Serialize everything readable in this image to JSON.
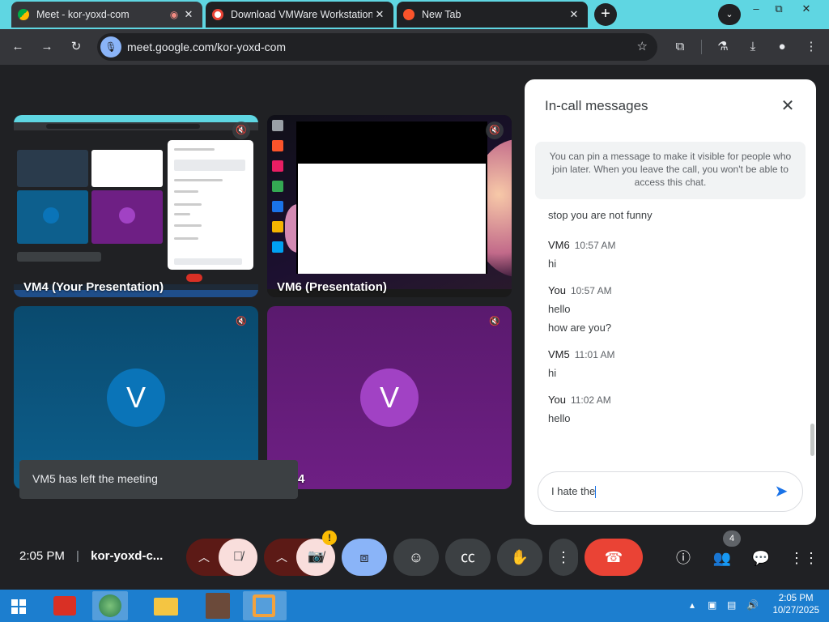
{
  "browser": {
    "tabs": [
      {
        "title": "Meet - kor-yoxd-com",
        "favicon": "google-meet-icon",
        "active": true
      },
      {
        "title": "Download VMWare Workstation",
        "favicon": "opera-icon",
        "active": false
      },
      {
        "title": "New Tab",
        "favicon": "brave-icon",
        "active": false
      }
    ],
    "url": "meet.google.com/kor-yoxd-com",
    "new_tab_glyph": "+",
    "window_controls": {
      "minimize": "–",
      "maximize": "⧉",
      "close": "✕"
    }
  },
  "meeting": {
    "tiles": [
      {
        "name": "VM4 (Your Presentation)",
        "kind": "presentation"
      },
      {
        "name": "VM6 (Presentation)",
        "kind": "presentation"
      },
      {
        "avatar_letter": "V",
        "color": "#0a74b8"
      },
      {
        "avatar_letter": "V",
        "color": "#a142c4",
        "partial_name": "4"
      }
    ],
    "toast": "VM5 has left the meeting",
    "clock": "2:05 PM",
    "meeting_code": "kor-yoxd-c...",
    "participant_count": "4",
    "camera_warning": "!"
  },
  "chat_panel": {
    "title": "In-call messages",
    "pin_note": "You can pin a message to make it visible for people who join later. When you leave the call, you won't be able to access this chat.",
    "orphan_line": "stop you are not funny",
    "messages": [
      {
        "sender": "VM6",
        "time": "10:57 AM",
        "lines": [
          "hi"
        ]
      },
      {
        "sender": "You",
        "time": "10:57 AM",
        "lines": [
          "hello",
          "how are you?"
        ]
      },
      {
        "sender": "VM5",
        "time": "11:01 AM",
        "lines": [
          "hi"
        ]
      },
      {
        "sender": "You",
        "time": "11:02 AM",
        "lines": [
          "hello"
        ]
      }
    ],
    "draft": "I hate the"
  },
  "taskbar": {
    "time": "2:05 PM",
    "date": "10/27/2025"
  },
  "colors": {
    "accent": "#1a73e8",
    "end_call": "#ea4335",
    "present_active": "#8ab4f8",
    "mic_off_bg": "#f9dedc"
  }
}
